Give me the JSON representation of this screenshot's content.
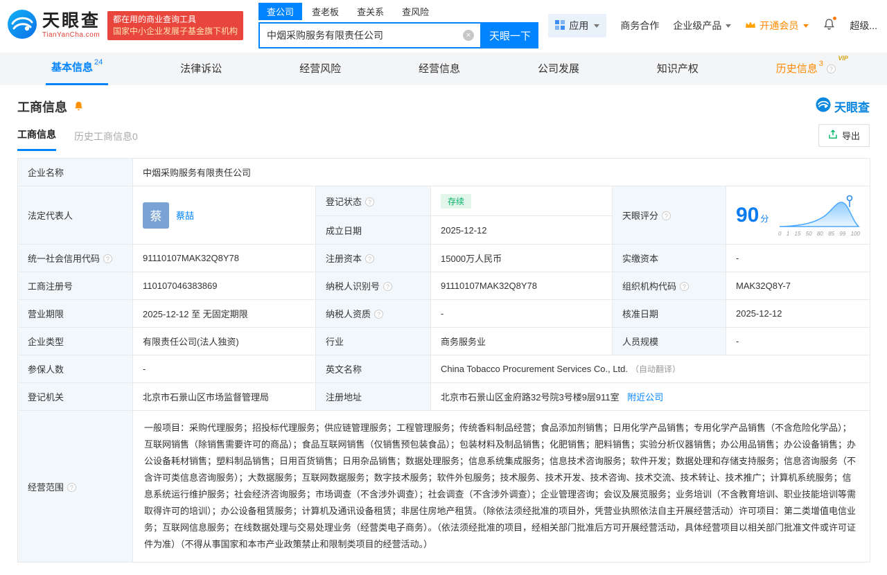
{
  "icons": {
    "info": "?",
    "clear": "×",
    "vip": "VIP"
  },
  "header": {
    "brand": "天眼查",
    "brand_domain": "TianYanCha.com",
    "slogan_line1": "都在用的商业查询工具",
    "slogan_line2": "国家中小企业发展子基金旗下机构",
    "search_tabs": [
      {
        "label": "查公司"
      },
      {
        "label": "查老板"
      },
      {
        "label": "查关系"
      },
      {
        "label": "查风险"
      }
    ],
    "search_value": "中烟采购服务有限责任公司",
    "search_button": "天眼一下",
    "menu_apps": "应用",
    "menu_cooperation": "商务合作",
    "menu_enterprise": "企业级产品",
    "menu_vip": "开通会员",
    "menu_super": "超级..."
  },
  "nav": {
    "tabs": [
      {
        "label": "基本信息",
        "count": "24"
      },
      {
        "label": "法律诉讼"
      },
      {
        "label": "经营风险"
      },
      {
        "label": "经营信息"
      },
      {
        "label": "公司发展"
      },
      {
        "label": "知识产权"
      },
      {
        "label": "历史信息",
        "count": "3"
      }
    ]
  },
  "section": {
    "title": "工商信息",
    "logo": "天眼查",
    "subtab_active": "工商信息",
    "subtab_history": "历史工商信息0",
    "export": "导出"
  },
  "info": {
    "company_name_label": "企业名称",
    "company_name": "中烟采购服务有限责任公司",
    "legal_rep_label": "法定代表人",
    "legal_rep_avatar": "蔡",
    "legal_rep_name": "蔡喆",
    "reg_status_label": "登记状态",
    "reg_status": "存续",
    "est_date_label": "成立日期",
    "est_date": "2025-12-12",
    "score_label": "天眼评分",
    "score": "90",
    "score_unit": "分",
    "score_axis": [
      "0",
      "1",
      "15",
      "50",
      "80",
      "85",
      "99",
      "100"
    ],
    "credit_code_label": "统一社会信用代码",
    "credit_code": "91110107MAK32Q8Y78",
    "reg_capital_label": "注册资本",
    "reg_capital": "15000万人民币",
    "paid_capital_label": "实缴资本",
    "paid_capital": "-",
    "reg_number_label": "工商注册号",
    "reg_number": "110107046383869",
    "taxpayer_id_label": "纳税人识别号",
    "taxpayer_id": "91110107MAK32Q8Y78",
    "org_code_label": "组织机构代码",
    "org_code": "MAK32Q8Y-7",
    "term_label": "营业期限",
    "term": "2025-12-12 至 无固定期限",
    "taxpayer_quality_label": "纳税人资质",
    "taxpayer_quality": "-",
    "approval_date_label": "核准日期",
    "approval_date": "2025-12-12",
    "company_type_label": "企业类型",
    "company_type": "有限责任公司(法人独资)",
    "industry_label": "行业",
    "industry": "商务服务业",
    "staff_label": "人员规模",
    "staff": "-",
    "insured_label": "参保人数",
    "insured": "-",
    "en_name_label": "英文名称",
    "en_name": "China Tobacco Procurement Services Co., Ltd.",
    "en_name_note": "（自动翻译）",
    "authority_label": "登记机关",
    "authority": "北京市石景山区市场监督管理局",
    "address_label": "注册地址",
    "address": "北京市石景山区金府路32号院3号楼9层911室",
    "address_link": "附近公司",
    "scope_label": "经营范围",
    "scope": "一般项目：采购代理服务；招投标代理服务；供应链管理服务；工程管理服务；传统香料制品经营；食品添加剂销售；日用化学产品销售；专用化学产品销售（不含危险化学品）；互联网销售（除销售需要许可的商品）；食品互联网销售（仅销售预包装食品）；包装材料及制品销售；化肥销售；肥料销售；实验分析仪器销售；办公用品销售；办公设备销售；办公设备耗材销售；塑料制品销售；日用百货销售；日用杂品销售；数据处理服务；信息系统集成服务；信息技术咨询服务；软件开发；数据处理和存储支持服务；信息咨询服务（不含许可类信息咨询服务）；大数据服务；互联网数据服务；数字技术服务；软件外包服务；技术服务、技术开发、技术咨询、技术交流、技术转让、技术推广；计算机系统服务；信息系统运行维护服务；社会经济咨询服务；市场调查（不含涉外调查）；社会调查（不含涉外调查）；企业管理咨询；会议及展览服务；业务培训（不含教育培训、职业技能培训等需取得许可的培训）；办公设备租赁服务；计算机及通讯设备租赁；非居住房地产租赁。（除依法须经批准的项目外，凭营业执照依法自主开展经营活动）许可项目：第二类增值电信业务；互联网信息服务；在线数据处理与交易处理业务（经营类电子商务）。（依法须经批准的项目，经相关部门批准后方可开展经营活动，具体经营项目以相关部门批准文件或许可证件为准）（不得从事国家和本市产业政策禁止和限制类项目的经营活动。）"
  }
}
